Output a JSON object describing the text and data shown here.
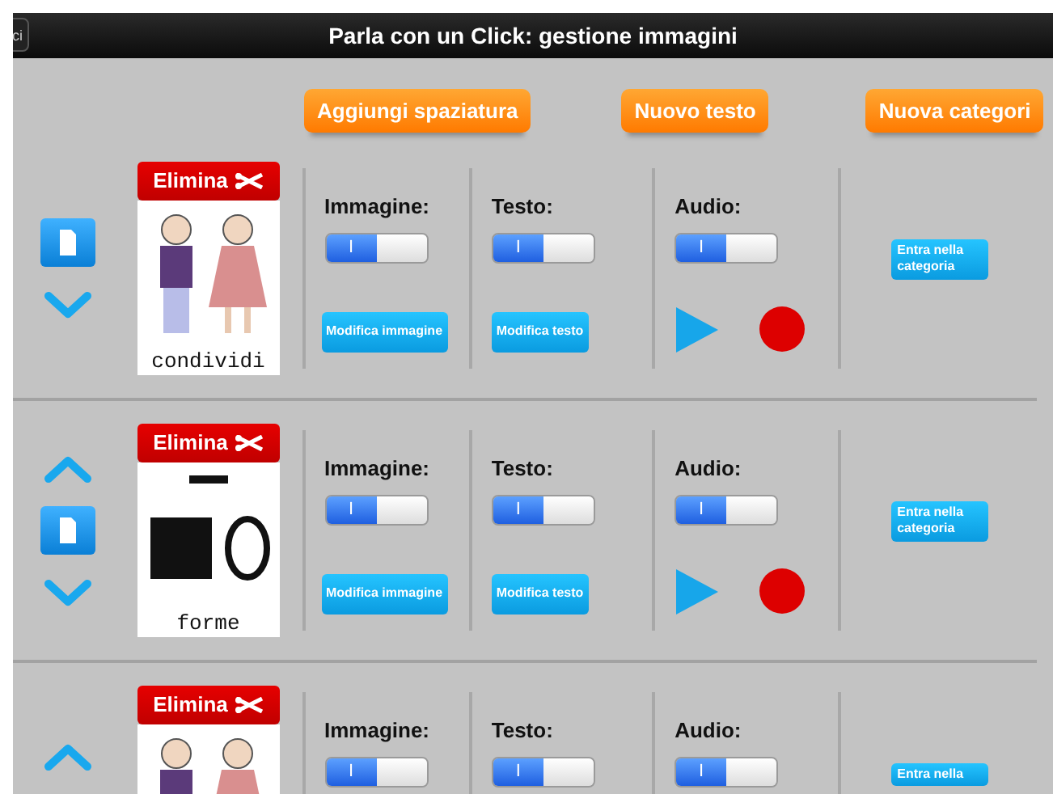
{
  "window": {
    "title": "Parla con un Click: gestione immagini",
    "back_button": "ci"
  },
  "toolbar": [
    "Aggiungi spaziatura",
    "Nuovo testo",
    "Nuova categori"
  ],
  "items": [
    {
      "move_up": false,
      "move_down": true,
      "delete_label": "Elimina",
      "kind": "people",
      "caption": "condividi",
      "switches": [
        {
          "label": "Immagine:",
          "on": true,
          "glyph": "I",
          "button": "Modifica immagine"
        },
        {
          "label": "Testo:",
          "on": true,
          "glyph": "I",
          "button": "Modifica testo"
        },
        {
          "label": "Audio:",
          "on": true,
          "glyph": "I",
          "audio_controls": true
        }
      ],
      "category_button": "Entra nella categoria"
    },
    {
      "move_up": true,
      "move_down": true,
      "delete_label": "Elimina",
      "kind": "shapes",
      "caption": "forme",
      "switches": [
        {
          "label": "Immagine:",
          "on": true,
          "glyph": "I",
          "button": "Modifica immagine"
        },
        {
          "label": "Testo:",
          "on": true,
          "glyph": "I",
          "button": "Modifica testo"
        },
        {
          "label": "Audio:",
          "on": true,
          "glyph": "I",
          "audio_controls": true
        }
      ],
      "category_button": "Entra nella categoria"
    },
    {
      "move_up": true,
      "move_down": false,
      "delete_label": "Elimina",
      "kind": "people",
      "switches": [
        {
          "label": "Immagine:",
          "on": true,
          "glyph": "I"
        },
        {
          "label": "Testo:",
          "on": true,
          "glyph": "I"
        },
        {
          "label": "Audio:",
          "on": true,
          "glyph": "I",
          "audio_controls": false
        }
      ],
      "category_button": "Entra nella"
    }
  ]
}
